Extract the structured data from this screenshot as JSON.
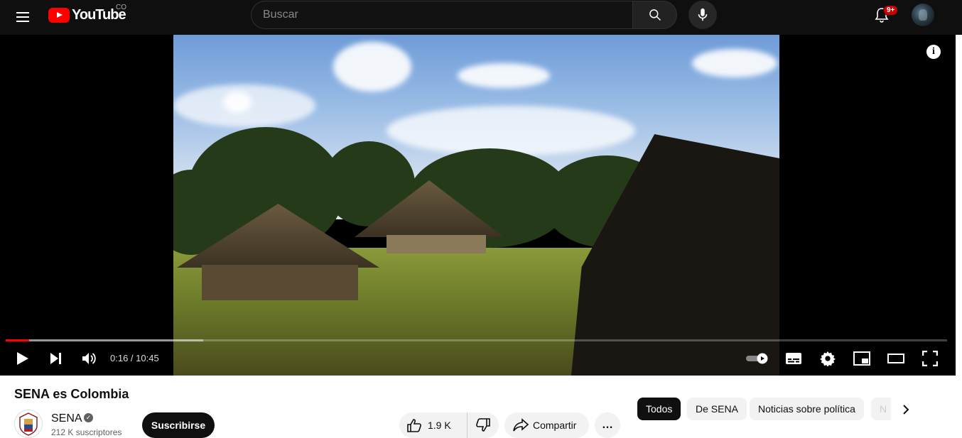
{
  "header": {
    "logo_text": "YouTube",
    "country_code": "CO",
    "search_placeholder": "Buscar",
    "notification_badge": "9+"
  },
  "player": {
    "current_time": "0:16",
    "separator": " / ",
    "duration": "10:45",
    "progress_played_fraction": 0.025,
    "progress_loaded_fraction": 0.21,
    "info_label": "i"
  },
  "video": {
    "title": "SENA es Colombia",
    "channel_name": "SENA",
    "subscribers": "212 K suscriptores",
    "subscribe_label": "Suscribirse",
    "like_count": "1.9 K",
    "share_label": "Compartir",
    "more_label": "…"
  },
  "chips": [
    {
      "label": "Todos",
      "active": true
    },
    {
      "label": "De SENA",
      "active": false
    },
    {
      "label": "Noticias sobre política",
      "active": false
    },
    {
      "label": "N",
      "active": false
    }
  ],
  "colors": {
    "brand_red": "#ff0000",
    "header_bg": "#0f0f0f"
  }
}
